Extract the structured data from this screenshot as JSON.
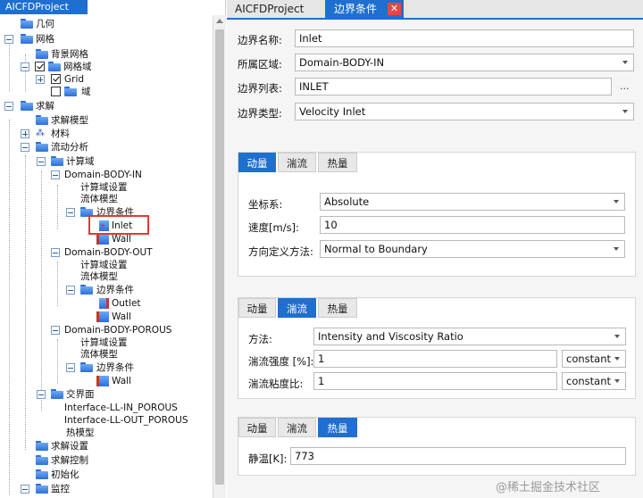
{
  "left_panel": {
    "title": "AICFDProject",
    "tree": [
      {
        "label": "几何"
      },
      {
        "label": "网格"
      },
      {
        "label": "背景网格"
      },
      {
        "label": "网格域"
      },
      {
        "label": "Grid"
      },
      {
        "label": "域"
      },
      {
        "label": "求解"
      },
      {
        "label": "求解模型"
      },
      {
        "label": "材料"
      },
      {
        "label": "流动分析"
      },
      {
        "label": "计算域"
      },
      {
        "label": "Domain-BODY-IN"
      },
      {
        "label": "计算域设置"
      },
      {
        "label": "流体模型"
      },
      {
        "label": "边界条件"
      },
      {
        "label": "Inlet"
      },
      {
        "label": "Wall"
      },
      {
        "label": "Domain-BODY-OUT"
      },
      {
        "label": "计算域设置"
      },
      {
        "label": "流体模型"
      },
      {
        "label": "边界条件"
      },
      {
        "label": "Outlet"
      },
      {
        "label": "Wall"
      },
      {
        "label": "Domain-BODY-POROUS"
      },
      {
        "label": "计算域设置"
      },
      {
        "label": "流体模型"
      },
      {
        "label": "边界条件"
      },
      {
        "label": "Wall"
      },
      {
        "label": "交界面"
      },
      {
        "label": "Interface-LL-IN_POROUS"
      },
      {
        "label": "Interface-LL-OUT_POROUS"
      },
      {
        "label": "热模型"
      },
      {
        "label": "求解设置"
      },
      {
        "label": "求解控制"
      },
      {
        "label": "初始化"
      },
      {
        "label": "监控"
      }
    ]
  },
  "tabs": {
    "project_tab": "AICFDProject",
    "boundary_tab": "边界条件",
    "close_glyph": "✕"
  },
  "form": {
    "name_label": "边界名称:",
    "name_value": "Inlet",
    "region_label": "所属区域:",
    "region_value": "Domain-BODY-IN",
    "list_label": "边界列表:",
    "list_value": "INLET",
    "list_dots": "...",
    "type_label": "边界类型:",
    "type_value": "Velocity Inlet"
  },
  "momentum_group": {
    "tabs": [
      "动量",
      "湍流",
      "热量"
    ],
    "coord_label": "坐标系:",
    "coord_value": "Absolute",
    "speed_label": "速度[m/s]:",
    "speed_value": "10",
    "dir_label": "方向定义方法:",
    "dir_value": "Normal to Boundary"
  },
  "turb_group": {
    "tabs": [
      "动量",
      "湍流",
      "热量"
    ],
    "method_label": "方法:",
    "method_value": "Intensity and Viscosity Ratio",
    "intensity_label": "湍流强度 [%]:",
    "intensity_value": "1",
    "intensity_mode": "constant",
    "ratio_label": "湍流粘度比:",
    "ratio_value": "1",
    "ratio_mode": "constant"
  },
  "heat_group": {
    "tabs": [
      "动量",
      "湍流",
      "热量"
    ],
    "temp_label": "静温[K]:",
    "temp_value": "773"
  },
  "watermark": "@稀土掘金技术社区",
  "colors": {
    "accent": "#1e6fd0",
    "highlight": "#e23a2d"
  }
}
